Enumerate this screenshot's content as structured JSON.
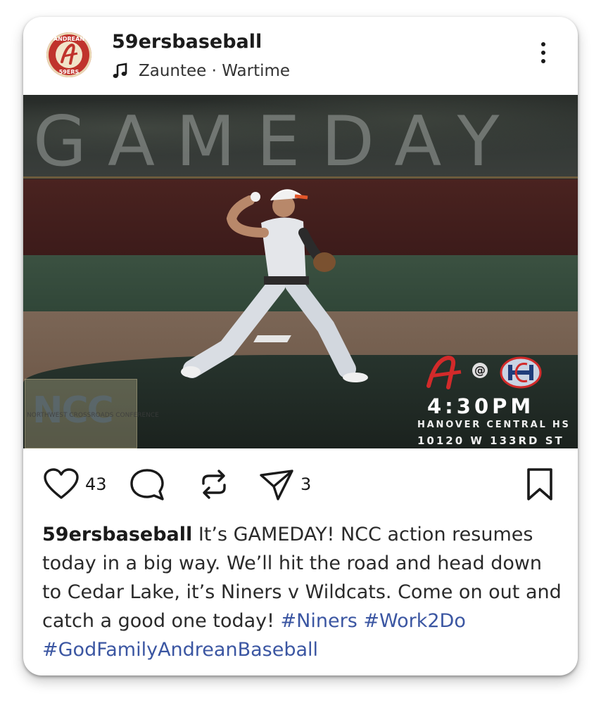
{
  "post": {
    "username": "59ersbaseball",
    "avatar_text_top": "ANDREAN",
    "avatar_text_bottom": "59ERS",
    "music": "Zauntee · Wartime"
  },
  "image": {
    "overlay_title": "GAMEDAY",
    "ncc_letters": "NCC",
    "ncc_subtitle": "NORTHWEST CROSSROADS CONFERENCE",
    "at_label": "@",
    "game_time": "4:30PM",
    "venue": "HANOVER CENTRAL HS",
    "address": "10120 W 133RD ST"
  },
  "actions": {
    "likes": "43",
    "shares": "3"
  },
  "caption": {
    "username": "59ersbaseball",
    "text": " It’s GAMEDAY! NCC action resumes today in a big way. We’ll hit the road and head down to Cedar Lake, it’s Niners v Wildcats. Come on out and catch a good one today! ",
    "hashtags": [
      "#Niners",
      "#Work2Do",
      "#GodFamilyAndreanBaseball"
    ]
  },
  "colors": {
    "hashtag": "#3b56a2",
    "avatar_red": "#c0332c"
  },
  "icons": [
    "music-note-icon",
    "more-icon",
    "heart-icon",
    "comment-icon",
    "repost-icon",
    "send-icon",
    "bookmark-icon"
  ]
}
